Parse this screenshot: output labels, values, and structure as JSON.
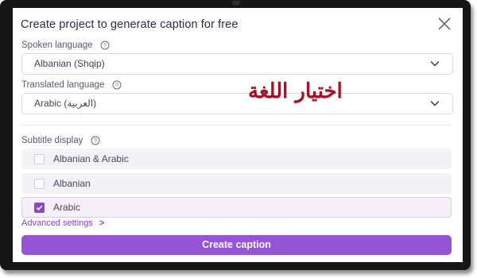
{
  "modal": {
    "title": "Create project to generate caption for free",
    "close_icon": "close-icon"
  },
  "spoken": {
    "label": "Spoken language",
    "value": "Albanian (Shqip)"
  },
  "translated": {
    "label": "Translated language",
    "value": "Arabic (العربية)"
  },
  "subtitle": {
    "label": "Subtitle display",
    "options": [
      {
        "label": "Albanian & Arabic",
        "checked": false
      },
      {
        "label": "Albanian",
        "checked": false
      },
      {
        "label": "Arabic",
        "checked": true
      }
    ]
  },
  "advanced": {
    "label": "Advanced settings",
    "arrow": ">"
  },
  "actions": {
    "create_label": "Create caption"
  },
  "overlay": {
    "text": "اختيار اللغة"
  },
  "colors": {
    "accent": "#9355d6",
    "checkbox": "#8b48cf",
    "overlay_text": "#a0152a"
  }
}
